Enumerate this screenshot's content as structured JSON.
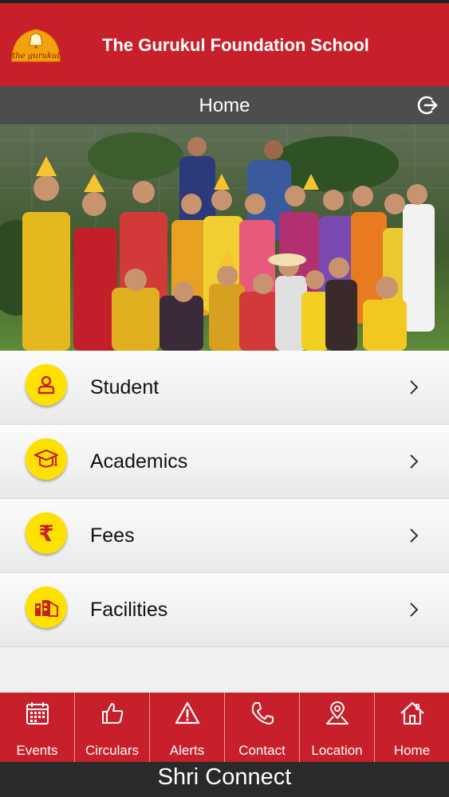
{
  "header": {
    "title": "The Gurukul Foundation School",
    "logo_text": "the gurukul"
  },
  "nav": {
    "title": "Home"
  },
  "menu": [
    {
      "label": "Student",
      "icon": "student-icon"
    },
    {
      "label": "Academics",
      "icon": "graduation-cap-icon"
    },
    {
      "label": "Fees",
      "icon": "rupee-icon"
    },
    {
      "label": "Facilities",
      "icon": "building-icon"
    }
  ],
  "tabs": [
    {
      "label": "Events",
      "icon": "calendar-icon"
    },
    {
      "label": "Circulars",
      "icon": "thumbs-up-icon"
    },
    {
      "label": "Alerts",
      "icon": "warning-icon"
    },
    {
      "label": "Contact",
      "icon": "phone-icon"
    },
    {
      "label": "Location",
      "icon": "map-pin-icon"
    },
    {
      "label": "Home",
      "icon": "house-icon"
    }
  ],
  "footer": {
    "text": "Shri Connect"
  },
  "colors": {
    "brand_red": "#c8202b",
    "nav_gray": "#4d4d4d",
    "icon_yellow": "#ffe100",
    "footer_dark": "#2a2a2a"
  }
}
